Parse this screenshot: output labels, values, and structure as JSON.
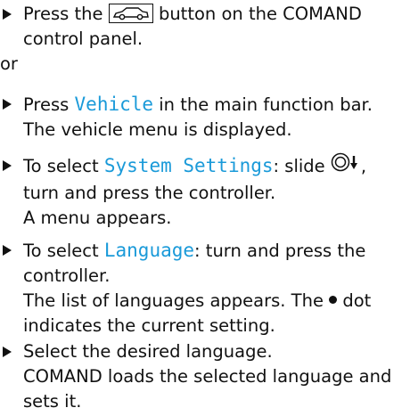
{
  "steps": [
    {
      "before": "Press the",
      "after": "button on the COMAND control panel.",
      "icon": "vehicle-button-icon"
    },
    {
      "before": "Press",
      "highlight": "Vehicle",
      "after": "in the main function bar.",
      "note": "The vehicle menu is displayed."
    },
    {
      "before": "To select",
      "highlight": "System Settings",
      "after": ": slide",
      "after2": ", turn and press the controller.",
      "note": "A menu appears.",
      "icon": "controller-slide-down-icon"
    },
    {
      "before": "To select",
      "highlight": "Language",
      "after": ": turn and press the controller.",
      "note_before": "The list of languages appears. The",
      "note_after": "dot indicates the current setting.",
      "icon": "bullet-dot-icon"
    },
    {
      "text": "Select the desired language.",
      "note": "COMAND loads the selected language and sets it."
    }
  ],
  "or_label": "or",
  "colors": {
    "highlight": "#1a9ad9",
    "text": "#111111"
  }
}
